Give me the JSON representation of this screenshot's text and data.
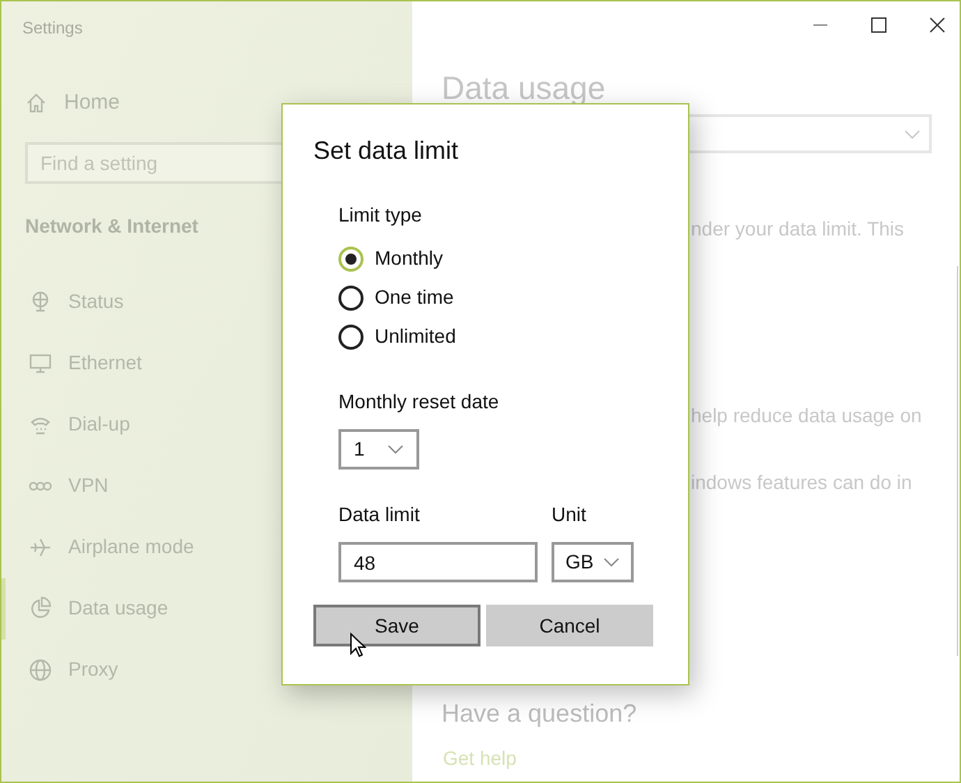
{
  "window": {
    "title": "Settings"
  },
  "sidebar": {
    "home": "Home",
    "search": {
      "placeholder": "Find a setting"
    },
    "section": "Network & Internet",
    "items": [
      {
        "label": "Status",
        "selected": false
      },
      {
        "label": "Ethernet",
        "selected": false
      },
      {
        "label": "Dial-up",
        "selected": false
      },
      {
        "label": "VPN",
        "selected": false
      },
      {
        "label": "Airplane mode",
        "selected": false
      },
      {
        "label": "Data usage",
        "selected": true
      },
      {
        "label": "Proxy",
        "selected": false
      }
    ]
  },
  "main": {
    "title": "Data usage",
    "lines": [
      "nder your data limit. This",
      "help reduce data usage on",
      "indows features can do in"
    ],
    "question": "Have a question?",
    "link": "Get help"
  },
  "dialog": {
    "title": "Set data limit",
    "limit_type": {
      "label": "Limit type",
      "options": [
        {
          "label": "Monthly",
          "selected": true
        },
        {
          "label": "One time",
          "selected": false
        },
        {
          "label": "Unlimited",
          "selected": false
        }
      ]
    },
    "reset_date": {
      "label": "Monthly reset date",
      "value": "1"
    },
    "data_limit": {
      "label": "Data limit",
      "value": "48"
    },
    "unit": {
      "label": "Unit",
      "value": "GB"
    },
    "buttons": [
      {
        "label": "Save",
        "focused": true
      },
      {
        "label": "Cancel",
        "focused": false
      }
    ]
  }
}
